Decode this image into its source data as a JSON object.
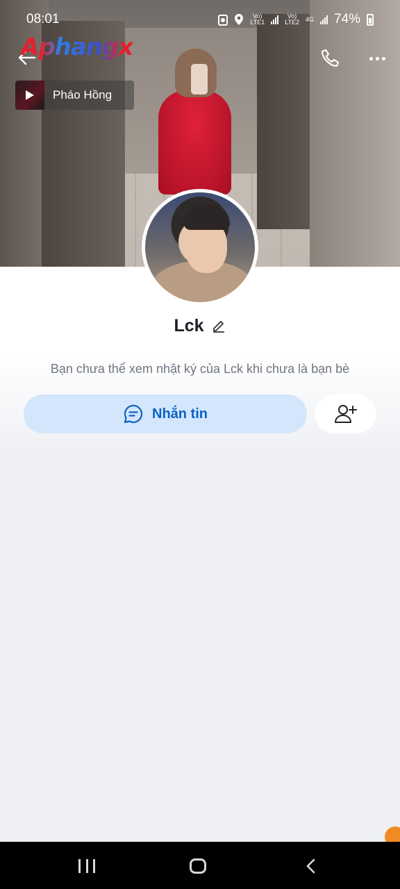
{
  "status_bar": {
    "time": "08:01",
    "sim1": "LTE1",
    "sim2": "LTE2",
    "network": "4G",
    "battery": "74%"
  },
  "watermark": "Aphangx",
  "music": {
    "title": "Pháo Hồng"
  },
  "profile": {
    "name": "Lck",
    "notice": "Bạn chưa thể xem nhật ký của Lck khi chưa là bạn bè",
    "message_label": "Nhắn tin"
  },
  "colors": {
    "accent": "#0a62c4",
    "button_bg": "#d3e6fb",
    "page_bg": "#eef0f4"
  },
  "icons": {
    "back": "arrow-left-icon",
    "call": "phone-icon",
    "more": "more-dots-icon",
    "edit": "pencil-icon",
    "message": "chat-bubble-icon",
    "add_friend": "add-user-icon"
  }
}
